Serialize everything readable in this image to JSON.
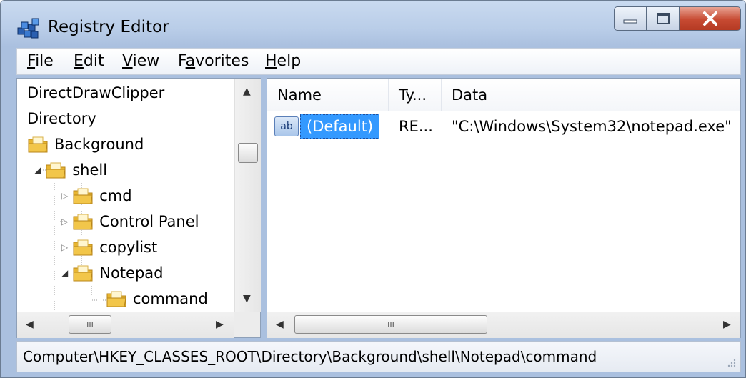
{
  "window": {
    "title": "Registry Editor"
  },
  "menu": [
    {
      "label": "File",
      "mnemonic": "F",
      "rest": "ile"
    },
    {
      "label": "Edit",
      "mnemonic": "E",
      "rest": "dit"
    },
    {
      "label": "View",
      "mnemonic": "V",
      "rest": "iew"
    },
    {
      "label": "Favorites",
      "pre": "F",
      "mnemonic": "a",
      "rest": "vorites"
    },
    {
      "label": "Help",
      "mnemonic": "H",
      "rest": "elp"
    }
  ],
  "tree": {
    "items": [
      {
        "label": "DirectDrawClipper"
      },
      {
        "label": "Directory"
      },
      {
        "label": "Background"
      },
      {
        "label": "shell"
      },
      {
        "label": "cmd"
      },
      {
        "label": "Control Panel"
      },
      {
        "label": "copylist"
      },
      {
        "label": "Notepad"
      },
      {
        "label": "command"
      }
    ]
  },
  "list": {
    "columns": {
      "name": "Name",
      "type": "Ty...",
      "data": "Data"
    },
    "rows": [
      {
        "icon": "string-value-icon",
        "icon_text": "ab",
        "name": "(Default)",
        "type": "RE...",
        "data": "\"C:\\Windows\\System32\\notepad.exe\""
      }
    ]
  },
  "scrollbars": {
    "grip": "III"
  },
  "status": {
    "path": "Computer\\HKEY_CLASSES_ROOT\\Directory\\Background\\shell\\Notepad\\command"
  },
  "colors": {
    "selection": "#3399ff",
    "folder": "#e8b530",
    "close_button": "#c74a32"
  }
}
